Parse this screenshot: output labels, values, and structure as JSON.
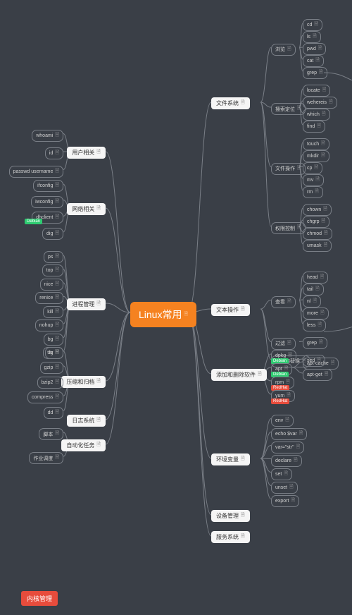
{
  "root": "Linux常用",
  "note_glyph": "🗎",
  "branches_left": [
    {
      "label": "用户相关",
      "leaves": [
        "whoami",
        "id",
        "passwd username"
      ]
    },
    {
      "label": "网络相关",
      "leaves": [
        "ifconfig",
        "iwconfig",
        "dhclient",
        "dig"
      ],
      "tags": {
        "2": "Debian"
      }
    },
    {
      "label": "进程管理",
      "leaves": [
        "ps",
        "top",
        "nice",
        "renice",
        "kill",
        "nohup",
        "bg",
        "fg"
      ]
    },
    {
      "label": "压缩和归档",
      "leaves": [
        "tar",
        "gzip",
        "bzip2",
        "compress",
        "dd"
      ]
    },
    {
      "label": "日志系统",
      "leaves": []
    },
    {
      "label": "自动化任务",
      "leaves": [
        "脚本",
        "作业调度"
      ]
    }
  ],
  "branches_right": [
    {
      "label": "文件系统",
      "groups": [
        {
          "label": "浏览",
          "leaves": [
            "cd",
            "ls",
            "pwd",
            "cat",
            "grep"
          ]
        },
        {
          "label": "搜索定位",
          "leaves": [
            "locate",
            "wehereis",
            "which",
            "find"
          ]
        },
        {
          "label": "文件操作",
          "leaves": [
            "touch",
            "mkdir",
            "cp",
            "mv",
            "rm"
          ]
        },
        {
          "label": "权限控制",
          "leaves": [
            "chown",
            "chgrp",
            "chmod",
            "umask"
          ]
        }
      ]
    },
    {
      "label": "文本操作",
      "groups": [
        {
          "label": "查看",
          "leaves": [
            "head",
            "tail",
            "nl",
            "more",
            "less"
          ]
        },
        {
          "label": "过滤",
          "leaves": [
            "grep"
          ]
        },
        {
          "label": "查找和替换",
          "leaves": [
            "sed"
          ]
        }
      ]
    },
    {
      "label": "添加和删除软件",
      "leaves": [
        "dpkg",
        "apt",
        "rpm",
        "yum"
      ],
      "sub": {
        "1": [
          "apt-cache",
          "apt-get"
        ]
      },
      "tags": {
        "0": "Debian",
        "1": "Debian",
        "2": "RedHat",
        "3": "RedHat"
      }
    },
    {
      "label": "环境变量",
      "leaves": [
        "env",
        "echo $var",
        "var=\"str\"",
        "declare",
        "set",
        "unset",
        "export"
      ]
    },
    {
      "label": "设备管理",
      "leaves": []
    },
    {
      "label": "服务系统",
      "leaves": []
    }
  ],
  "floating_tag": "内核管理"
}
